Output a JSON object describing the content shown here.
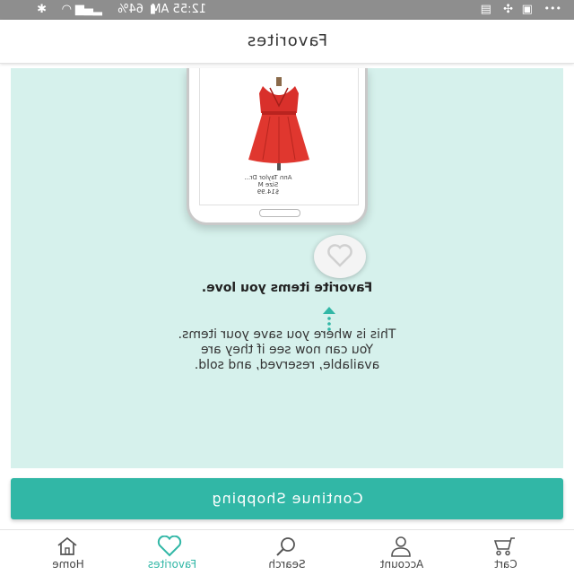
{
  "status_bar": {
    "time": "12:55 AM",
    "battery_percent": "64%",
    "signal_icon": "signal-icon",
    "wifi_icon": "wifi-icon",
    "bluetooth_icon": "bluetooth-icon",
    "more_icon": "more-dots-icon"
  },
  "header": {
    "title": "Favorites"
  },
  "onboarding": {
    "product": {
      "name": "Ann Taylor Dr...",
      "size": "Size M",
      "price": "$14.99"
    },
    "headline": "Favorite items you love.",
    "body_lines": [
      "This is where you save your items.",
      "You can now see if they are",
      "available, reserved, and sold."
    ]
  },
  "cta": {
    "label": "Continue Shopping"
  },
  "bottom_nav": {
    "items": [
      {
        "label": "Home",
        "icon": "home-icon"
      },
      {
        "label": "Favorites",
        "icon": "heart-icon",
        "active": true
      },
      {
        "label": "Search",
        "icon": "search-icon"
      },
      {
        "label": "Account",
        "icon": "user-icon"
      },
      {
        "label": "Cart",
        "icon": "cart-icon"
      }
    ]
  },
  "colors": {
    "accent": "#31b7a6",
    "panel": "#d6f1ec",
    "status_bar": "#8e8e8e",
    "dress": "#d9302b"
  }
}
